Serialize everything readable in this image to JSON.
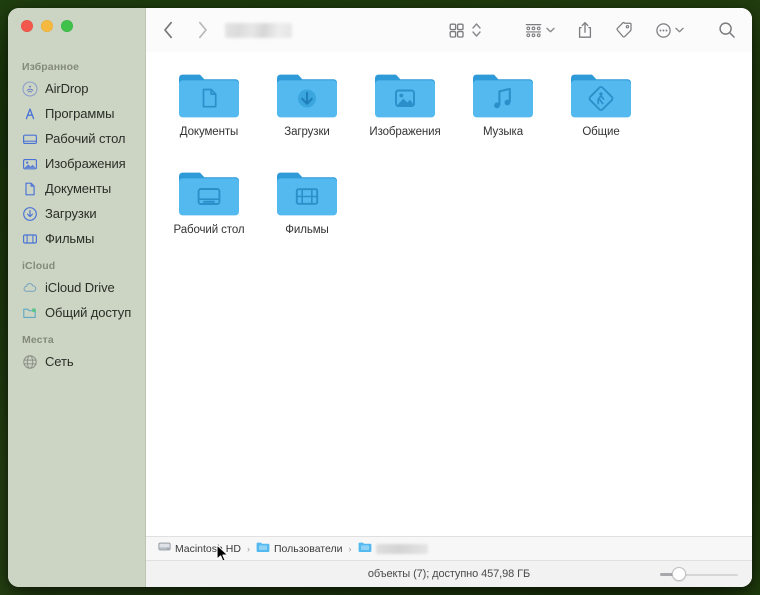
{
  "desktop": {
    "background_color": "#1d3a0d"
  },
  "window": {
    "title_redacted": true,
    "controls": {
      "close_label": "Закрыть",
      "minimize_label": "Свернуть",
      "maximize_label": "Развернуть"
    }
  },
  "toolbar": {
    "back_label": "‹",
    "forward_label": "›",
    "icon_view_label": "Вид значками",
    "sort_label": "Сортировка",
    "group_label": "Группировка",
    "share_label": "Поделиться",
    "tag_label": "Теги",
    "more_label": "Еще",
    "search_label": "Поиск"
  },
  "sidebar": {
    "sections": [
      {
        "title": "Избранное",
        "items": [
          {
            "label": "AirDrop",
            "icon": "airdrop-icon"
          },
          {
            "label": "Программы",
            "icon": "applications-icon"
          },
          {
            "label": "Рабочий стол",
            "icon": "desktop-icon"
          },
          {
            "label": "Изображения",
            "icon": "pictures-icon"
          },
          {
            "label": "Документы",
            "icon": "documents-icon"
          },
          {
            "label": "Загрузки",
            "icon": "downloads-icon"
          },
          {
            "label": "Фильмы",
            "icon": "movies-icon"
          }
        ]
      },
      {
        "title": "iCloud",
        "items": [
          {
            "label": "iCloud Drive",
            "icon": "icloud-drive-icon"
          },
          {
            "label": "Общий доступ",
            "icon": "shared-folder-icon"
          }
        ]
      },
      {
        "title": "Места",
        "items": [
          {
            "label": "Сеть",
            "icon": "network-icon"
          }
        ]
      }
    ]
  },
  "content": {
    "items": [
      {
        "label": "Документы",
        "icon": "folder-documents-icon"
      },
      {
        "label": "Загрузки",
        "icon": "folder-downloads-icon"
      },
      {
        "label": "Изображения",
        "icon": "folder-pictures-icon"
      },
      {
        "label": "Музыка",
        "icon": "folder-music-icon"
      },
      {
        "label": "Общие",
        "icon": "folder-public-icon"
      },
      {
        "label": "Рабочий стол",
        "icon": "folder-desktop-icon"
      },
      {
        "label": "Фильмы",
        "icon": "folder-movies-icon"
      }
    ]
  },
  "pathbar": {
    "crumbs": [
      {
        "label": "Macintosh HD",
        "icon": "harddisk-icon",
        "redacted": false
      },
      {
        "label": "Пользователи",
        "icon": "folder-icon",
        "redacted": false
      },
      {
        "label": "",
        "icon": "folder-icon",
        "redacted": true
      }
    ],
    "separator": "›"
  },
  "statusbar": {
    "text": "объекты (7); доступно 457,98 ГБ",
    "zoom_slider_value": 20
  },
  "colors": {
    "sidebar_bg": "#ccd5c3",
    "folder_blue": "#53b9ef",
    "folder_blue_dark": "#2c97d4",
    "accent_blue": "#3a7bd5"
  }
}
